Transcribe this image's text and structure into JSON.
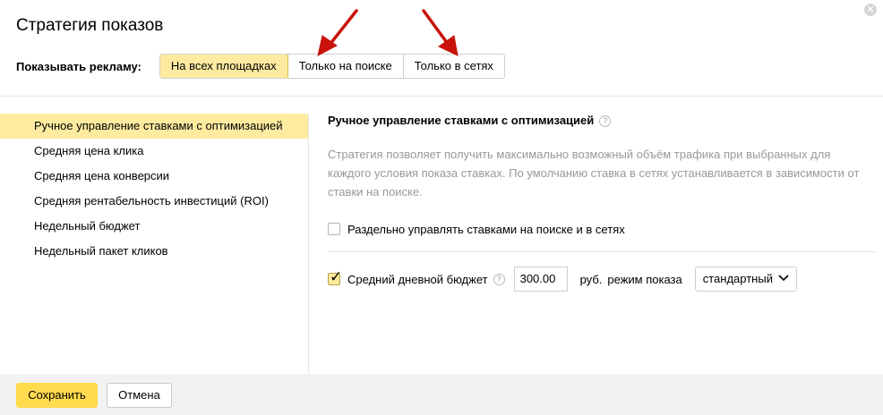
{
  "dialog": {
    "title": "Стратегия показов",
    "close_icon": "close-icon"
  },
  "show_ads": {
    "label": "Показывать рекламу:",
    "options": [
      "На всех площадках",
      "Только на поиске",
      "Только в сетях"
    ],
    "selected": "На всех площадках"
  },
  "strategies": {
    "items": [
      "Ручное управление ставками с оптимизацией",
      "Средняя цена клика",
      "Средняя цена конверсии",
      "Средняя рентабельность инвестиций (ROI)",
      "Недельный бюджет",
      "Недельный пакет кликов"
    ],
    "selected": "Ручное управление ставками с оптимизацией"
  },
  "details": {
    "title": "Ручное управление ставками с оптимизацией",
    "help_icon": "question-icon",
    "description": "Стратегия позволяет получить максимально возможный объём трафика при выбранных для каждого условия показа ставках. По умолчанию ставка в сетях устанавливается в зависимости от ставки на поиске.",
    "separate_bids_label": "Раздельно управлять ставками на поиске и в сетях",
    "separate_bids_checked": false,
    "daily_budget_label": "Средний дневной бюджет",
    "daily_budget_checked": true,
    "daily_budget_value": "300.00",
    "currency_label": "руб.",
    "mode_label": "режим показа",
    "mode_value": "стандартный"
  },
  "footer": {
    "save_label": "Сохранить",
    "cancel_label": "Отмена"
  },
  "annotations": {
    "arrow_color": "#c8120b"
  },
  "colors": {
    "accent_yellow": "#ffdb4d",
    "selected_bg": "#ffeba0"
  }
}
